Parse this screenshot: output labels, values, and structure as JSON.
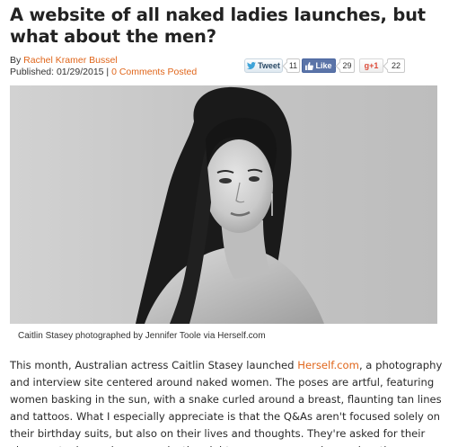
{
  "article": {
    "title": "A website of all naked ladies launches, but what about the men?",
    "by_label": "By ",
    "author": "Rachel Kramer Bussel",
    "published_label": "Published: 01/29/2015 | ",
    "comments_link": "0 Comments Posted"
  },
  "share": {
    "tweet_label": "Tweet",
    "tweet_count": "11",
    "like_label": "Like",
    "like_count": "29",
    "gplus_label": "g+1",
    "gplus_count": "22"
  },
  "photo": {
    "caption": "Caitlin Stasey photographed by Jennifer Toole via Herself.com"
  },
  "body": {
    "intro_before_link": "This month, Australian actress Caitlin Stasey launched ",
    "link_text": "Herself.com",
    "intro_after_link": ", a photography and interview site centered around naked women. The poses are artful, featuring women basking in the sun, with a snake curled around a breast, flaunting tan lines and tattoos. What I especially appreciate is that the Q&As aren't focused solely on their birthday suits, but also on their lives and thoughts. They're asked for their views on topics such as reproductive rights, monogamy and sex education."
  },
  "colors": {
    "link": "#e0661b",
    "like_button": "#5b74a8",
    "gplus": "#dd4b39"
  }
}
